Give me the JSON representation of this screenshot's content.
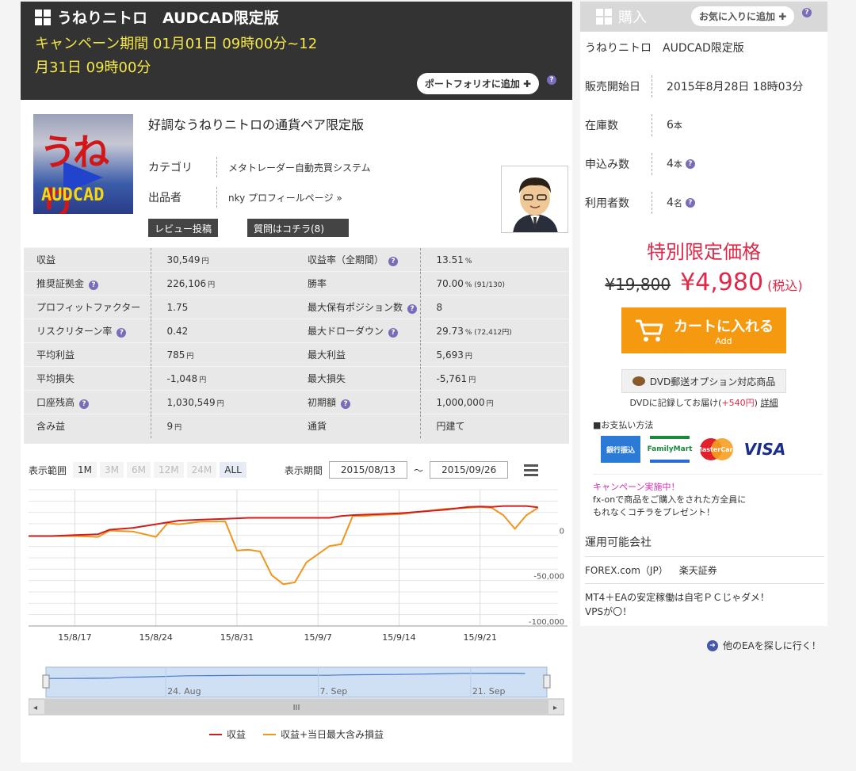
{
  "header": {
    "title": "うねりニトロ　AUDCAD限定版",
    "campaign": "キャンペーン期間 01月01日 09時00分~12月31日 09時00分",
    "portfolio_button": "ポートフォリオに追加"
  },
  "product": {
    "image_text_top": "うねり",
    "image_text_bottom": "AUDCAD",
    "headline": "好調なうねりニトロの通貨ペア限定版",
    "category_label": "カテゴリ",
    "category_value": "メタトレーダー自動売買システム",
    "seller_label": "出品者",
    "seller_value": "nky プロフィールページ »",
    "review_button": "レビュー投稿",
    "question_button": "質問はコチラ(8)"
  },
  "stats": [
    {
      "l1": "収益",
      "v1": "30,549",
      "u1": "円",
      "l2": "収益率（全期間）",
      "v2": "13.51",
      "u2": "%",
      "h1": false,
      "h2": true
    },
    {
      "l1": "推奨証拠金",
      "v1": "226,106",
      "u1": "円",
      "l2": "勝率",
      "v2": "70.00",
      "u2": "% (91/130)",
      "h1": true,
      "h2": false
    },
    {
      "l1": "プロフィットファクター",
      "v1": "1.75",
      "u1": "",
      "l2": "最大保有ポジション数",
      "v2": "8",
      "u2": "",
      "h1": false,
      "h2": true
    },
    {
      "l1": "リスクリターン率",
      "v1": "0.42",
      "u1": "",
      "l2": "最大ドローダウン",
      "v2": "29.73",
      "u2": "% (72,412円)",
      "h1": true,
      "h2": true
    },
    {
      "l1": "平均利益",
      "v1": "785",
      "u1": "円",
      "l2": "最大利益",
      "v2": "5,693",
      "u2": "円",
      "h1": false,
      "h2": false
    },
    {
      "l1": "平均損失",
      "v1": "-1,048",
      "u1": "円",
      "l2": "最大損失",
      "v2": "-5,761",
      "u2": "円",
      "h1": false,
      "h2": false
    },
    {
      "l1": "口座残高",
      "v1": "1,030,549",
      "u1": "円",
      "l2": "初期額",
      "v2": "1,000,000",
      "u2": "円",
      "h1": true,
      "h2": true
    },
    {
      "l1": "含み益",
      "v1": "9",
      "u1": "円",
      "l2": "通貨",
      "v2": "円建て",
      "u2": "",
      "h1": false,
      "h2": false
    }
  ],
  "chart_controls": {
    "range_label": "表示範囲",
    "ranges": [
      "1M",
      "3M",
      "6M",
      "12M",
      "24M",
      "ALL"
    ],
    "period_label": "表示期間",
    "from": "2015/08/13",
    "tilde": "～",
    "to": "2015/09/26"
  },
  "chart_data": {
    "type": "line",
    "x": [
      "2015-08-13",
      "2015-08-15",
      "2015-08-17",
      "2015-08-19",
      "2015-08-20",
      "2015-08-22",
      "2015-08-24",
      "2015-08-25",
      "2015-08-26",
      "2015-08-28",
      "2015-08-30",
      "2015-08-31",
      "2015-09-01",
      "2015-09-02",
      "2015-09-03",
      "2015-09-04",
      "2015-09-05",
      "2015-09-06",
      "2015-09-08",
      "2015-09-09",
      "2015-09-10",
      "2015-09-11",
      "2015-09-12",
      "2015-09-14",
      "2015-09-16",
      "2015-09-18",
      "2015-09-20",
      "2015-09-21",
      "2015-09-22",
      "2015-09-23",
      "2015-09-24",
      "2015-09-25",
      "2015-09-26"
    ],
    "series": [
      {
        "name": "収益",
        "color": "#cc1f1f",
        "values": [
          -1000,
          -1000,
          0,
          1000,
          6000,
          8000,
          12000,
          14000,
          16000,
          17000,
          18000,
          18500,
          19000,
          19000,
          19000,
          19000,
          19000,
          19000,
          19000,
          21000,
          22000,
          22500,
          23000,
          24000,
          26000,
          28000,
          31000,
          31500,
          31000,
          32000,
          32000,
          32000,
          30549
        ]
      },
      {
        "name": "収益+当日最大含み損益",
        "color": "#f0961e",
        "values": [
          -1000,
          -1000,
          -1000,
          -2000,
          5000,
          4000,
          -2000,
          13000,
          12000,
          15000,
          15000,
          -17000,
          -16000,
          -18000,
          -44000,
          -54000,
          -52000,
          -30000,
          -12000,
          -10000,
          21000,
          21000,
          22000,
          23000,
          26000,
          29000,
          30000,
          31000,
          30000,
          22000,
          7000,
          22000,
          30000
        ]
      }
    ],
    "x_ticks": [
      "15/8/17",
      "15/8/24",
      "15/8/31",
      "15/9/7",
      "15/9/14",
      "15/9/21"
    ],
    "y_ticks": [
      "0",
      "-50,000",
      "-100,000"
    ],
    "ylim": [
      -100000,
      50000
    ],
    "navigator_ticks": [
      "24. Aug",
      "7. Sep",
      "21. Sep"
    ],
    "navigator_scroll_label": "III"
  },
  "sidebar": {
    "buy_label": "購入",
    "favorite_button": "お気に入りに追加",
    "product_name": "うねりニトロ　AUDCAD限定版",
    "rows": [
      {
        "label": "販売開始日",
        "value": "2015年8月28日 18時03分",
        "unit": "",
        "help": false
      },
      {
        "label": "在庫数",
        "value": "6",
        "unit": "本",
        "help": false
      },
      {
        "label": "申込み数",
        "value": "4",
        "unit": "本",
        "help": true
      },
      {
        "label": "利用者数",
        "value": "4",
        "unit": "名",
        "help": true
      }
    ],
    "special_price_label": "特別限定価格",
    "old_price": "¥19,800",
    "new_price": "¥4,980",
    "tax_label": "(税込)",
    "cart_button": "カートに入れる",
    "cart_sub": "Add",
    "dvd_button": "DVD郵送オプション対応商品",
    "dvd_note_a": "DVDに記録してお届け(",
    "dvd_note_price": "+540円",
    "dvd_note_b": ")",
    "dvd_note_link": "詳細",
    "payment_label": "■お支払い方法",
    "payments": [
      "銀行振込",
      "FamilyMart",
      "MasterCard",
      "VISA"
    ],
    "campaign_title": "キャンペーン実施中！",
    "campaign_line1": "fx-onで商品をご購入をされた方全員に",
    "campaign_line2": "もれなくコチラをプレゼント！"
  },
  "companies": {
    "title": "運用可能会社",
    "names": [
      "FOREX.com（JP）",
      "楽天証券"
    ],
    "note1": "MT4＋EAの安定稼働は自宅ＰＣじゃダメ！",
    "note2": "VPSが〇！"
  },
  "other_link": "他のEAを探しに行く！"
}
